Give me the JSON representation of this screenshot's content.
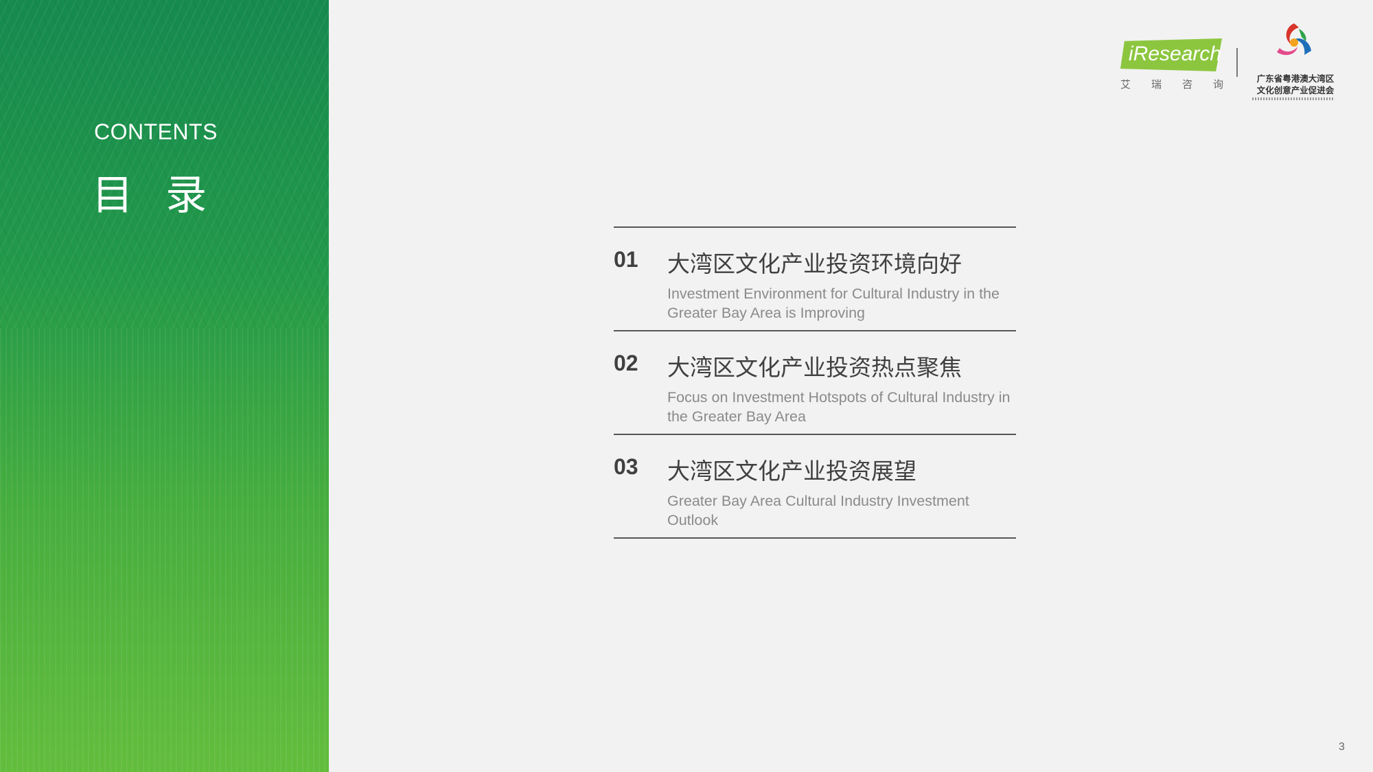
{
  "sidebar": {
    "label": "CONTENTS",
    "title": "目 录"
  },
  "logos": {
    "iresearch": {
      "name": "iResearch",
      "cn_chars": [
        "艾",
        "瑞",
        "咨",
        "询"
      ],
      "brand_color": "#8cc63f"
    },
    "gd_association": {
      "name_line1": "广东省粤港澳大湾区",
      "name_line2": "文化创意产业促进会"
    }
  },
  "toc": {
    "items": [
      {
        "number": "01",
        "title_cn": "大湾区文化产业投资环境向好",
        "title_en": "Investment Environment for Cultural Industry in the Greater Bay Area is Improving"
      },
      {
        "number": "02",
        "title_cn": "大湾区文化产业投资热点聚焦",
        "title_en": "Focus on Investment Hotspots of Cultural Industry in the Greater Bay Area"
      },
      {
        "number": "03",
        "title_cn": "大湾区文化产业投资展望",
        "title_en": "Greater Bay Area Cultural Industry Investment Outlook"
      }
    ]
  },
  "page_number": "3",
  "colors": {
    "sidebar_top": "#168a4f",
    "sidebar_bottom": "#63bd3d",
    "background": "#f2f2f2",
    "text_dark": "#404040",
    "text_muted": "#8a8a8a"
  }
}
